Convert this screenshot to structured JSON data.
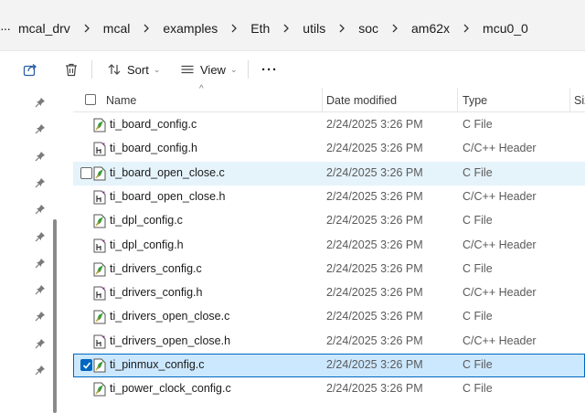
{
  "breadcrumb": {
    "overflow": "···",
    "items": [
      "mcal_drv",
      "mcal",
      "examples",
      "Eth",
      "utils",
      "soc",
      "am62x",
      "mcu0_0"
    ]
  },
  "toolbar": {
    "share_icon": "share-icon",
    "delete_icon": "trash-icon",
    "sort_label": "Sort",
    "view_label": "View",
    "more_label": "···"
  },
  "columns": {
    "name": "Name",
    "date": "Date modified",
    "type": "Type",
    "size": "Siz"
  },
  "files": [
    {
      "name": "ti_board_config.c",
      "date": "2/24/2025 3:26 PM",
      "type": "C File",
      "kind": "c"
    },
    {
      "name": "ti_board_config.h",
      "date": "2/24/2025 3:26 PM",
      "type": "C/C++ Header",
      "kind": "h"
    },
    {
      "name": "ti_board_open_close.c",
      "date": "2/24/2025 3:26 PM",
      "type": "C File",
      "kind": "c",
      "state": "hover"
    },
    {
      "name": "ti_board_open_close.h",
      "date": "2/24/2025 3:26 PM",
      "type": "C/C++ Header",
      "kind": "h"
    },
    {
      "name": "ti_dpl_config.c",
      "date": "2/24/2025 3:26 PM",
      "type": "C File",
      "kind": "c"
    },
    {
      "name": "ti_dpl_config.h",
      "date": "2/24/2025 3:26 PM",
      "type": "C/C++ Header",
      "kind": "h"
    },
    {
      "name": "ti_drivers_config.c",
      "date": "2/24/2025 3:26 PM",
      "type": "C File",
      "kind": "c"
    },
    {
      "name": "ti_drivers_config.h",
      "date": "2/24/2025 3:26 PM",
      "type": "C/C++ Header",
      "kind": "h"
    },
    {
      "name": "ti_drivers_open_close.c",
      "date": "2/24/2025 3:26 PM",
      "type": "C File",
      "kind": "c"
    },
    {
      "name": "ti_drivers_open_close.h",
      "date": "2/24/2025 3:26 PM",
      "type": "C/C++ Header",
      "kind": "h"
    },
    {
      "name": "ti_pinmux_config.c",
      "date": "2/24/2025 3:26 PM",
      "type": "C File",
      "kind": "c",
      "state": "selected"
    },
    {
      "name": "ti_power_clock_config.c",
      "date": "2/24/2025 3:26 PM",
      "type": "C File",
      "kind": "c"
    }
  ],
  "nav_pins": 11,
  "colors": {
    "accent": "#0067c0",
    "hover_row": "#e5f3fb",
    "selected_row": "#cce8ff",
    "c_file_green": "#3a9c3a"
  }
}
